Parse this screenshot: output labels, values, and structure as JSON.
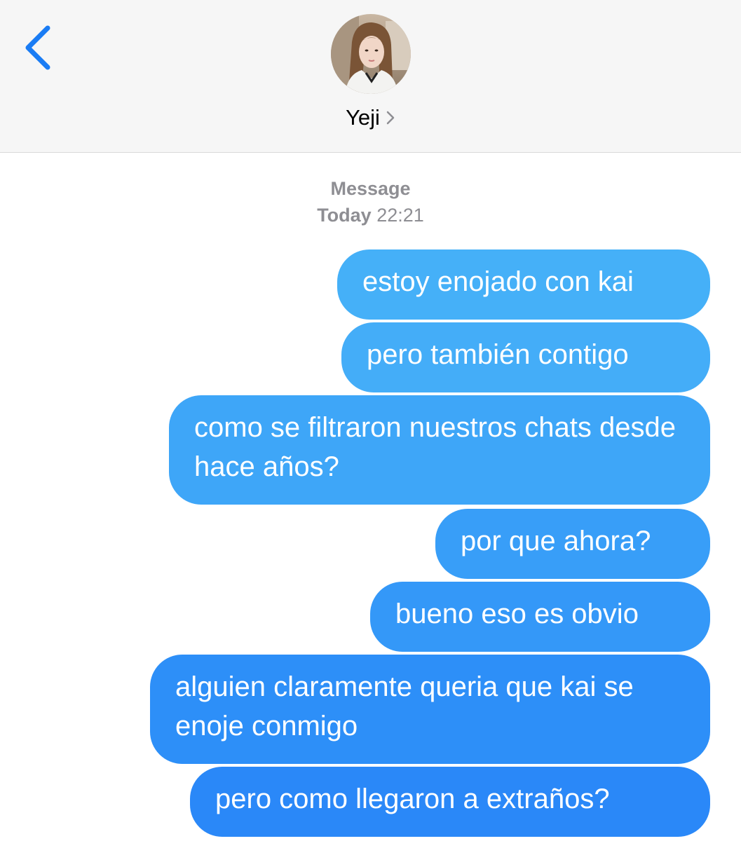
{
  "header": {
    "back_icon": "chevron-left-icon",
    "avatar": "contact-photo",
    "contact_name": "Yeji",
    "contact_chevron": "chevron-right-icon"
  },
  "meta": {
    "service": "Message",
    "day": "Today",
    "time": "22:21"
  },
  "messages": [
    {
      "text": "estoy enojado con kai",
      "color": "#45b0f8"
    },
    {
      "text": "pero también contigo",
      "color": "#44adf8"
    },
    {
      "text": "como se filtraron nuestros chats desde hace años?",
      "color": "#3ea6f8"
    },
    {
      "text": "por que ahora?",
      "color": "#389ef8"
    },
    {
      "text": "bueno eso es obvio",
      "color": "#3498f8"
    },
    {
      "text": "alguien claramente queria que kai se enoje conmigo",
      "color": "#2d8ff8"
    },
    {
      "text": "pero como llegaron a extraños?",
      "color": "#2a88f8"
    }
  ],
  "colors": {
    "ios_blue": "#1a7cf4",
    "header_bg": "#f6f6f6",
    "meta_gray": "#8e8e93"
  }
}
